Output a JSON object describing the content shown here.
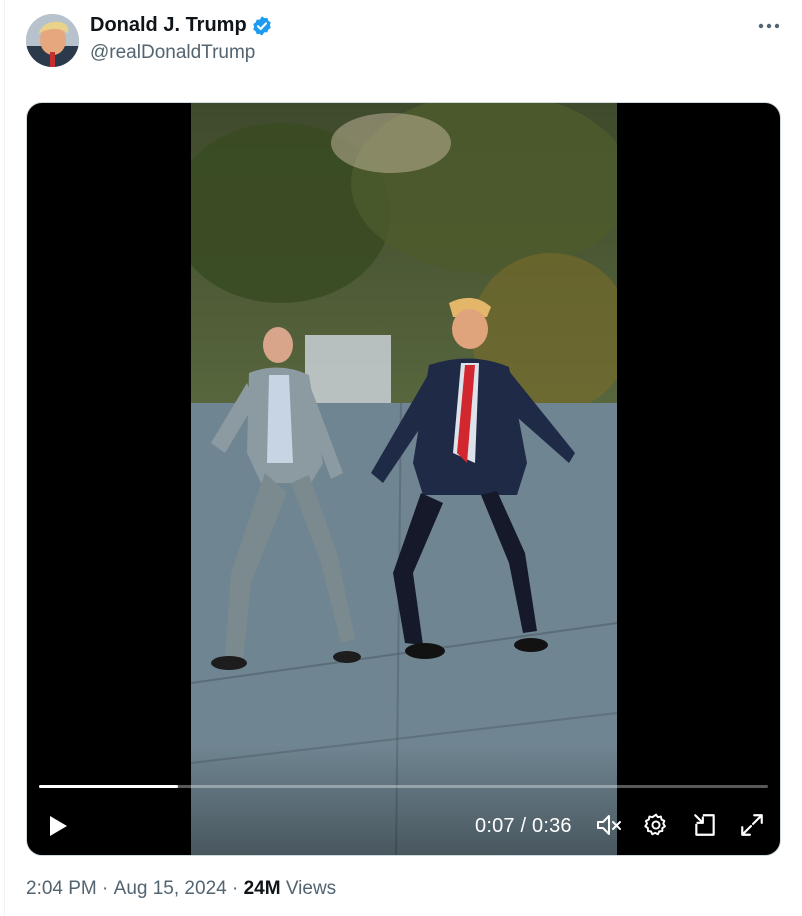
{
  "post": {
    "author_name": "Donald J. Trump",
    "author_handle": "@realDonaldTrump",
    "verified": true,
    "accent_color": "#1d9bf0"
  },
  "video": {
    "current_time": "0:07",
    "separator": " / ",
    "duration": "0:36",
    "progress_fraction": 0.19,
    "muted": true,
    "icons": [
      "play-icon",
      "mute-icon",
      "settings-icon",
      "pip-icon",
      "fullscreen-icon"
    ]
  },
  "meta": {
    "time": "2:04 PM",
    "dot1": " · ",
    "date": "Aug 15, 2024",
    "dot2": " · ",
    "views_count": "24M",
    "views_label": " Views"
  }
}
